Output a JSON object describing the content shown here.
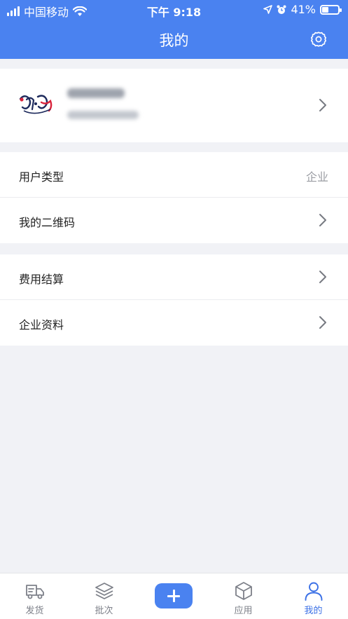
{
  "status_bar": {
    "carrier": "中国移动",
    "time": "下午 9:18",
    "battery": "41%",
    "battery_level": 0.41
  },
  "header": {
    "title": "我的",
    "settings_icon": "gear-icon"
  },
  "profile": {
    "avatar_icon": "company-logo",
    "name": "",
    "phone": ""
  },
  "menu_group_1": [
    {
      "label": "用户类型",
      "value": "企业"
    },
    {
      "label": "我的二维码",
      "value": ""
    }
  ],
  "menu_group_2": [
    {
      "label": "费用结算",
      "value": ""
    },
    {
      "label": "企业资料",
      "value": ""
    }
  ],
  "tabbar": {
    "tabs": [
      {
        "label": "发货",
        "icon": "truck-icon"
      },
      {
        "label": "批次",
        "icon": "layers-icon"
      },
      {
        "label": "",
        "icon": "plus-icon"
      },
      {
        "label": "应用",
        "icon": "cube-icon"
      },
      {
        "label": "我的",
        "icon": "user-icon"
      }
    ],
    "active_index": 4
  },
  "colors": {
    "brand": "#4a82f0",
    "active_tab": "#3c71e6",
    "background": "#f1f2f6"
  }
}
